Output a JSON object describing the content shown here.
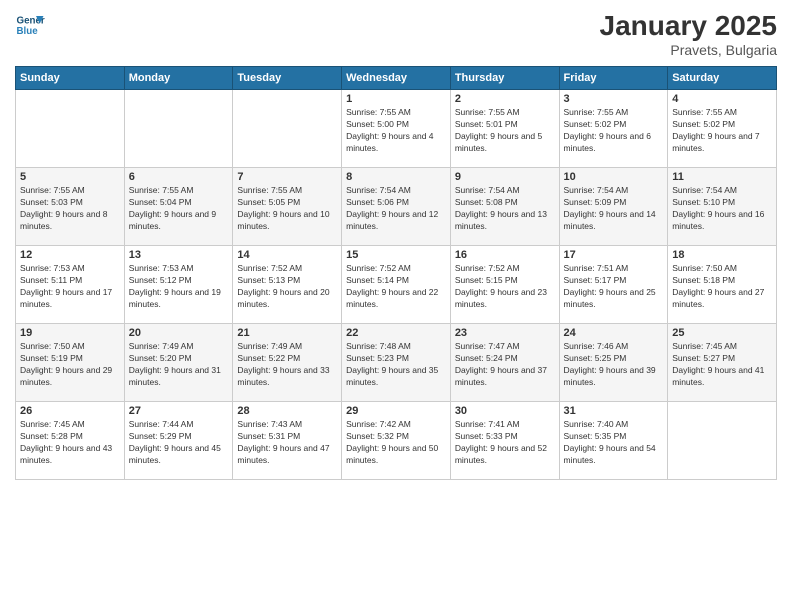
{
  "header": {
    "logo_line1": "General",
    "logo_line2": "Blue",
    "month": "January 2025",
    "location": "Pravets, Bulgaria"
  },
  "weekdays": [
    "Sunday",
    "Monday",
    "Tuesday",
    "Wednesday",
    "Thursday",
    "Friday",
    "Saturday"
  ],
  "weeks": [
    [
      {
        "day": "",
        "sunrise": "",
        "sunset": "",
        "daylight": ""
      },
      {
        "day": "",
        "sunrise": "",
        "sunset": "",
        "daylight": ""
      },
      {
        "day": "",
        "sunrise": "",
        "sunset": "",
        "daylight": ""
      },
      {
        "day": "1",
        "sunrise": "Sunrise: 7:55 AM",
        "sunset": "Sunset: 5:00 PM",
        "daylight": "Daylight: 9 hours and 4 minutes."
      },
      {
        "day": "2",
        "sunrise": "Sunrise: 7:55 AM",
        "sunset": "Sunset: 5:01 PM",
        "daylight": "Daylight: 9 hours and 5 minutes."
      },
      {
        "day": "3",
        "sunrise": "Sunrise: 7:55 AM",
        "sunset": "Sunset: 5:02 PM",
        "daylight": "Daylight: 9 hours and 6 minutes."
      },
      {
        "day": "4",
        "sunrise": "Sunrise: 7:55 AM",
        "sunset": "Sunset: 5:02 PM",
        "daylight": "Daylight: 9 hours and 7 minutes."
      }
    ],
    [
      {
        "day": "5",
        "sunrise": "Sunrise: 7:55 AM",
        "sunset": "Sunset: 5:03 PM",
        "daylight": "Daylight: 9 hours and 8 minutes."
      },
      {
        "day": "6",
        "sunrise": "Sunrise: 7:55 AM",
        "sunset": "Sunset: 5:04 PM",
        "daylight": "Daylight: 9 hours and 9 minutes."
      },
      {
        "day": "7",
        "sunrise": "Sunrise: 7:55 AM",
        "sunset": "Sunset: 5:05 PM",
        "daylight": "Daylight: 9 hours and 10 minutes."
      },
      {
        "day": "8",
        "sunrise": "Sunrise: 7:54 AM",
        "sunset": "Sunset: 5:06 PM",
        "daylight": "Daylight: 9 hours and 12 minutes."
      },
      {
        "day": "9",
        "sunrise": "Sunrise: 7:54 AM",
        "sunset": "Sunset: 5:08 PM",
        "daylight": "Daylight: 9 hours and 13 minutes."
      },
      {
        "day": "10",
        "sunrise": "Sunrise: 7:54 AM",
        "sunset": "Sunset: 5:09 PM",
        "daylight": "Daylight: 9 hours and 14 minutes."
      },
      {
        "day": "11",
        "sunrise": "Sunrise: 7:54 AM",
        "sunset": "Sunset: 5:10 PM",
        "daylight": "Daylight: 9 hours and 16 minutes."
      }
    ],
    [
      {
        "day": "12",
        "sunrise": "Sunrise: 7:53 AM",
        "sunset": "Sunset: 5:11 PM",
        "daylight": "Daylight: 9 hours and 17 minutes."
      },
      {
        "day": "13",
        "sunrise": "Sunrise: 7:53 AM",
        "sunset": "Sunset: 5:12 PM",
        "daylight": "Daylight: 9 hours and 19 minutes."
      },
      {
        "day": "14",
        "sunrise": "Sunrise: 7:52 AM",
        "sunset": "Sunset: 5:13 PM",
        "daylight": "Daylight: 9 hours and 20 minutes."
      },
      {
        "day": "15",
        "sunrise": "Sunrise: 7:52 AM",
        "sunset": "Sunset: 5:14 PM",
        "daylight": "Daylight: 9 hours and 22 minutes."
      },
      {
        "day": "16",
        "sunrise": "Sunrise: 7:52 AM",
        "sunset": "Sunset: 5:15 PM",
        "daylight": "Daylight: 9 hours and 23 minutes."
      },
      {
        "day": "17",
        "sunrise": "Sunrise: 7:51 AM",
        "sunset": "Sunset: 5:17 PM",
        "daylight": "Daylight: 9 hours and 25 minutes."
      },
      {
        "day": "18",
        "sunrise": "Sunrise: 7:50 AM",
        "sunset": "Sunset: 5:18 PM",
        "daylight": "Daylight: 9 hours and 27 minutes."
      }
    ],
    [
      {
        "day": "19",
        "sunrise": "Sunrise: 7:50 AM",
        "sunset": "Sunset: 5:19 PM",
        "daylight": "Daylight: 9 hours and 29 minutes."
      },
      {
        "day": "20",
        "sunrise": "Sunrise: 7:49 AM",
        "sunset": "Sunset: 5:20 PM",
        "daylight": "Daylight: 9 hours and 31 minutes."
      },
      {
        "day": "21",
        "sunrise": "Sunrise: 7:49 AM",
        "sunset": "Sunset: 5:22 PM",
        "daylight": "Daylight: 9 hours and 33 minutes."
      },
      {
        "day": "22",
        "sunrise": "Sunrise: 7:48 AM",
        "sunset": "Sunset: 5:23 PM",
        "daylight": "Daylight: 9 hours and 35 minutes."
      },
      {
        "day": "23",
        "sunrise": "Sunrise: 7:47 AM",
        "sunset": "Sunset: 5:24 PM",
        "daylight": "Daylight: 9 hours and 37 minutes."
      },
      {
        "day": "24",
        "sunrise": "Sunrise: 7:46 AM",
        "sunset": "Sunset: 5:25 PM",
        "daylight": "Daylight: 9 hours and 39 minutes."
      },
      {
        "day": "25",
        "sunrise": "Sunrise: 7:45 AM",
        "sunset": "Sunset: 5:27 PM",
        "daylight": "Daylight: 9 hours and 41 minutes."
      }
    ],
    [
      {
        "day": "26",
        "sunrise": "Sunrise: 7:45 AM",
        "sunset": "Sunset: 5:28 PM",
        "daylight": "Daylight: 9 hours and 43 minutes."
      },
      {
        "day": "27",
        "sunrise": "Sunrise: 7:44 AM",
        "sunset": "Sunset: 5:29 PM",
        "daylight": "Daylight: 9 hours and 45 minutes."
      },
      {
        "day": "28",
        "sunrise": "Sunrise: 7:43 AM",
        "sunset": "Sunset: 5:31 PM",
        "daylight": "Daylight: 9 hours and 47 minutes."
      },
      {
        "day": "29",
        "sunrise": "Sunrise: 7:42 AM",
        "sunset": "Sunset: 5:32 PM",
        "daylight": "Daylight: 9 hours and 50 minutes."
      },
      {
        "day": "30",
        "sunrise": "Sunrise: 7:41 AM",
        "sunset": "Sunset: 5:33 PM",
        "daylight": "Daylight: 9 hours and 52 minutes."
      },
      {
        "day": "31",
        "sunrise": "Sunrise: 7:40 AM",
        "sunset": "Sunset: 5:35 PM",
        "daylight": "Daylight: 9 hours and 54 minutes."
      },
      {
        "day": "",
        "sunrise": "",
        "sunset": "",
        "daylight": ""
      }
    ]
  ]
}
